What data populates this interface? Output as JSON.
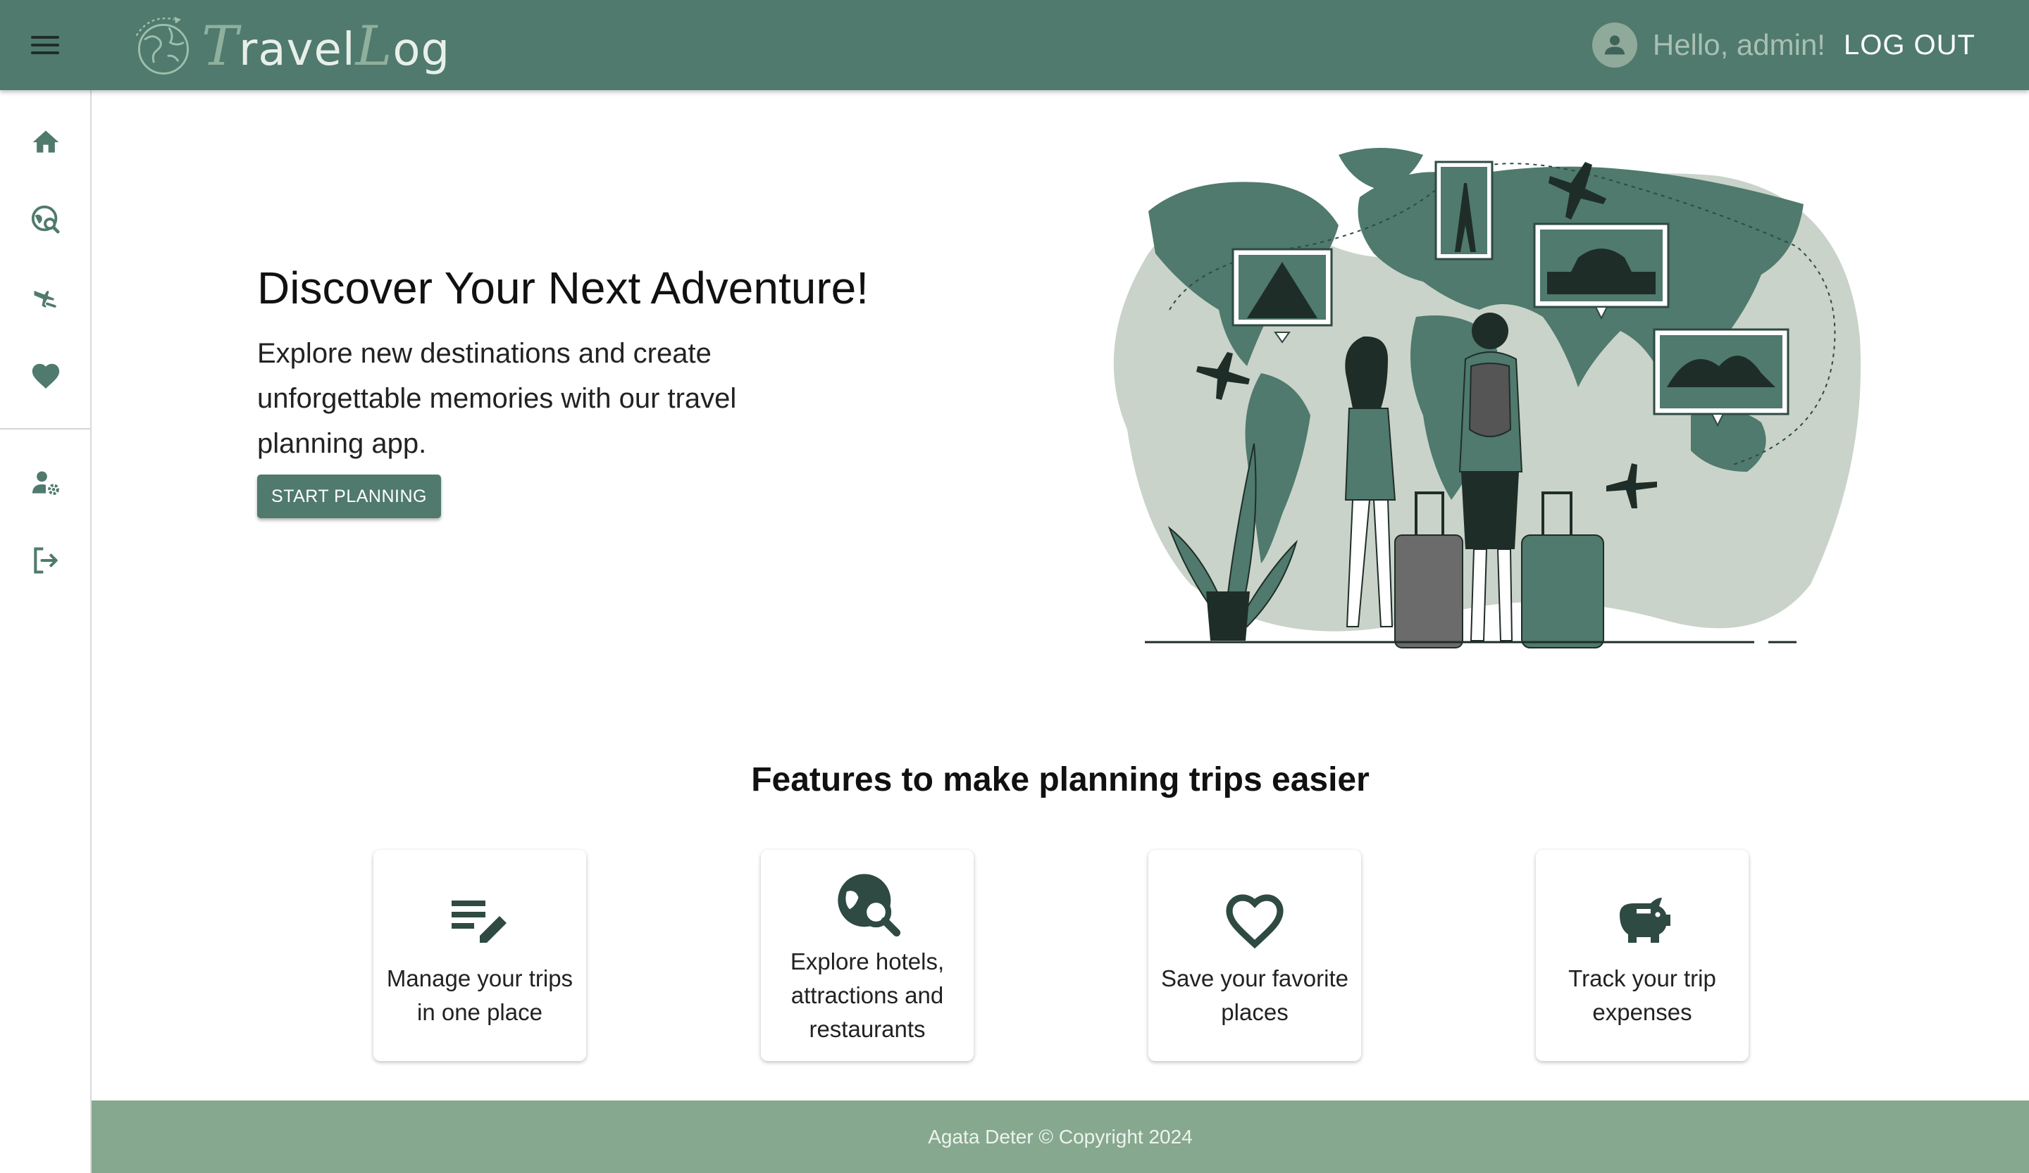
{
  "app": {
    "logo_text_cap1": "T",
    "logo_text_part1": "ravel",
    "logo_text_cap2": "L",
    "logo_text_part2": "og"
  },
  "header": {
    "greeting": "Hello, admin!",
    "logout_label": "LOG OUT"
  },
  "sidebar": {
    "items": [
      {
        "icon": "home-icon"
      },
      {
        "icon": "travel-explore-icon"
      },
      {
        "icon": "flights-icon"
      },
      {
        "icon": "favorite-icon"
      },
      {
        "icon": "manage-accounts-icon"
      },
      {
        "icon": "logout-icon"
      }
    ]
  },
  "hero": {
    "title": "Discover Your Next Adventure!",
    "text": "Explore new destinations and create unforgettable memories with our travel planning app.",
    "cta_label": "START PLANNING"
  },
  "features": {
    "title": "Features to make planning trips easier",
    "cards": [
      {
        "icon": "edit-note-icon",
        "label": "Manage your trips in one place"
      },
      {
        "icon": "travel-explore-icon",
        "label": "Explore hotels, attractions and restaurants"
      },
      {
        "icon": "heart-outline-icon",
        "label": "Save your favorite places"
      },
      {
        "icon": "piggy-bank-icon",
        "label": "Track your trip expenses"
      }
    ]
  },
  "footer": {
    "text": "Agata Deter © Copyright 2024"
  },
  "colors": {
    "header_bg": "#4f7a6d",
    "footer_bg": "#86a88e",
    "accent": "#4f7a6d",
    "icon_dark": "#2e4a42"
  }
}
